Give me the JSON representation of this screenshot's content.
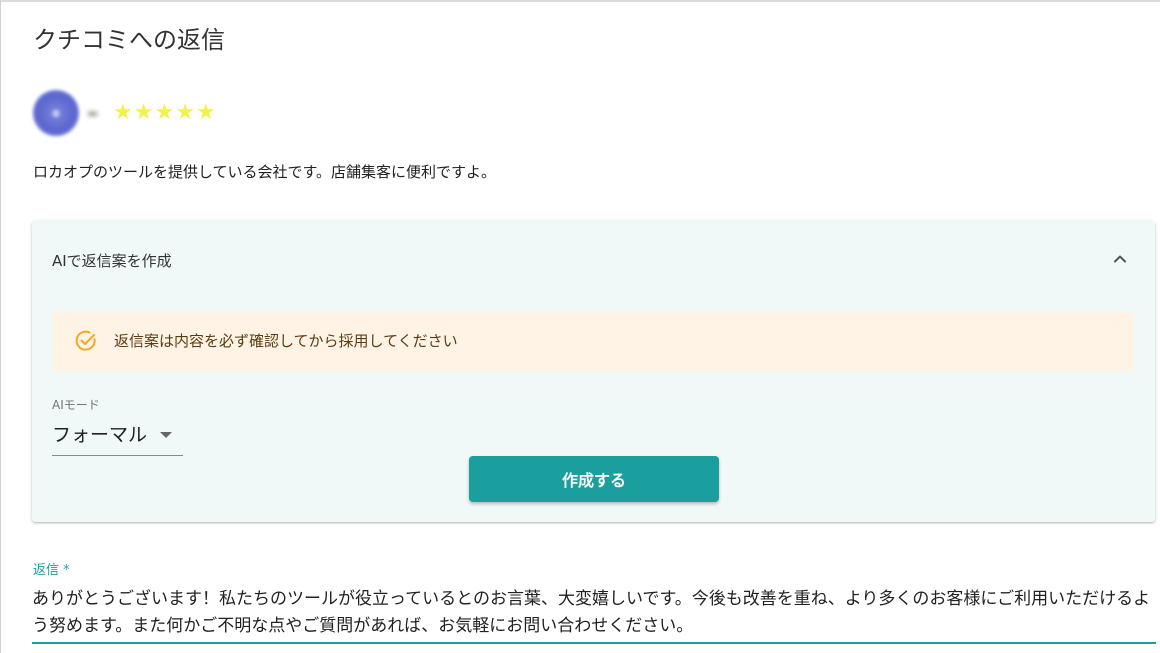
{
  "dialog": {
    "title": "クチコミへの返信"
  },
  "review": {
    "stars": [
      "★",
      "★",
      "★",
      "★",
      "★"
    ],
    "star_color": "#f2f24a",
    "rating": 5,
    "text": "ロカオプのツールを提供している会社です。店舗集客に便利ですよ。"
  },
  "ai_panel": {
    "title": "AIで返信案を作成",
    "expand_icon": "chevron-up-icon",
    "alert": {
      "icon": "check-circle-icon",
      "text": "返信案は内容を必ず確認してから採用してください"
    },
    "mode": {
      "label": "AIモード",
      "value": "フォーマル"
    },
    "create_button_label": "作成する"
  },
  "reply": {
    "label": "返信 *",
    "value": "ありがとうございます！私たちのツールが役立っているとのお言葉、大変嬉しいです。今後も改善を重ね、より多くのお客様にご利用いただけるよう努めます。また何かご不明な点やご質問があれば、お気軽にお問い合わせください。"
  },
  "colors": {
    "accent": "#1a9e9e",
    "panel_bg": "#f1f8f8",
    "alert_bg": "#fef3e5",
    "alert_icon": "#f5a623"
  }
}
